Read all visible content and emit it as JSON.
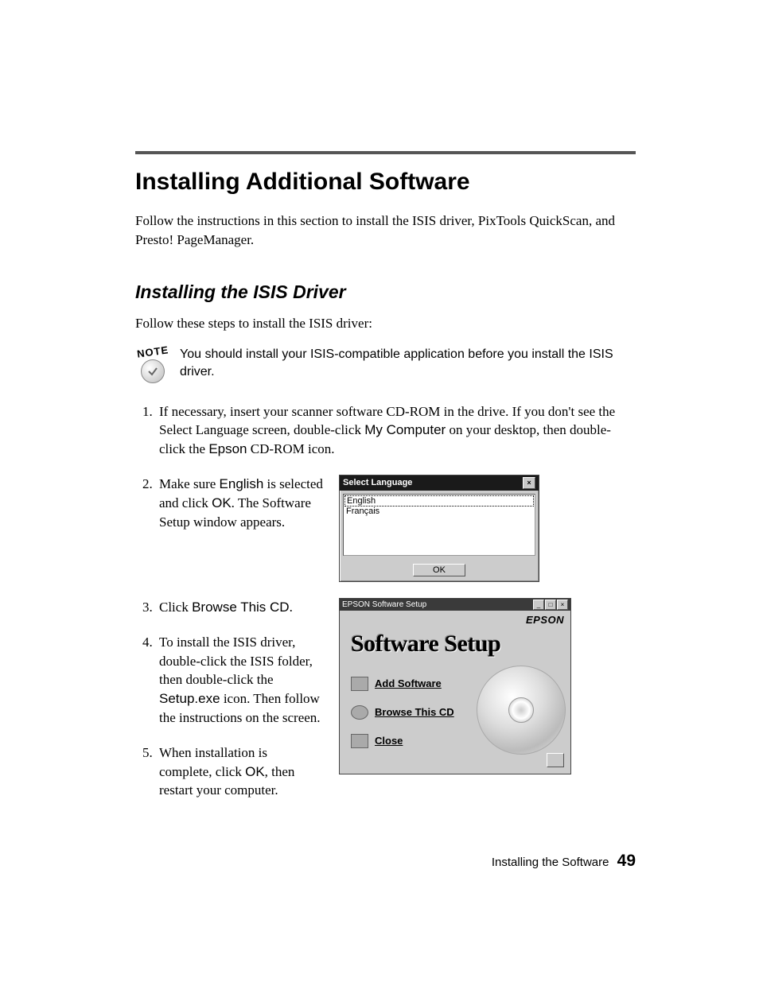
{
  "heading": "Installing Additional Software",
  "intro": "Follow the instructions in this section to install the ISIS driver, PixTools QuickScan, and Presto! PageManager.",
  "subheading": "Installing the ISIS Driver",
  "lead": "Follow these steps to install the ISIS driver:",
  "note": {
    "badge": "NOTE",
    "text": "You should install your ISIS-compatible application before you install the ISIS driver."
  },
  "steps": {
    "s1_a": "If necessary, insert your scanner software CD-ROM in the drive. If you don't see the Select Language screen, double-click ",
    "s1_b": "My Computer",
    "s1_c": " on your desktop, then double-click the ",
    "s1_d": "Epson",
    "s1_e": " CD-ROM icon.",
    "s2_a": "Make sure ",
    "s2_b": "English",
    "s2_c": " is selected and click ",
    "s2_d": "OK",
    "s2_e": ". The Software Setup window appears.",
    "s3_a": "Click ",
    "s3_b": "Browse This CD",
    "s3_c": ".",
    "s4_a": "To install the ISIS driver, double-click the ISIS folder, then double-click the ",
    "s4_b": "Setup.exe",
    "s4_c": " icon. Then follow the instructions on the screen.",
    "s5_a": "When installation is complete, click ",
    "s5_b": "OK",
    "s5_c": ", then restart your computer."
  },
  "dialog_lang": {
    "title": "Select Language",
    "options": [
      "English",
      "Français"
    ],
    "ok": "OK"
  },
  "window_setup": {
    "title": "EPSON Software Setup",
    "brand": "EPSON",
    "heading": "Software Setup",
    "links": [
      "Add Software",
      "Browse This CD",
      "Close"
    ]
  },
  "footer": {
    "section": "Installing the Software",
    "page": "49"
  }
}
